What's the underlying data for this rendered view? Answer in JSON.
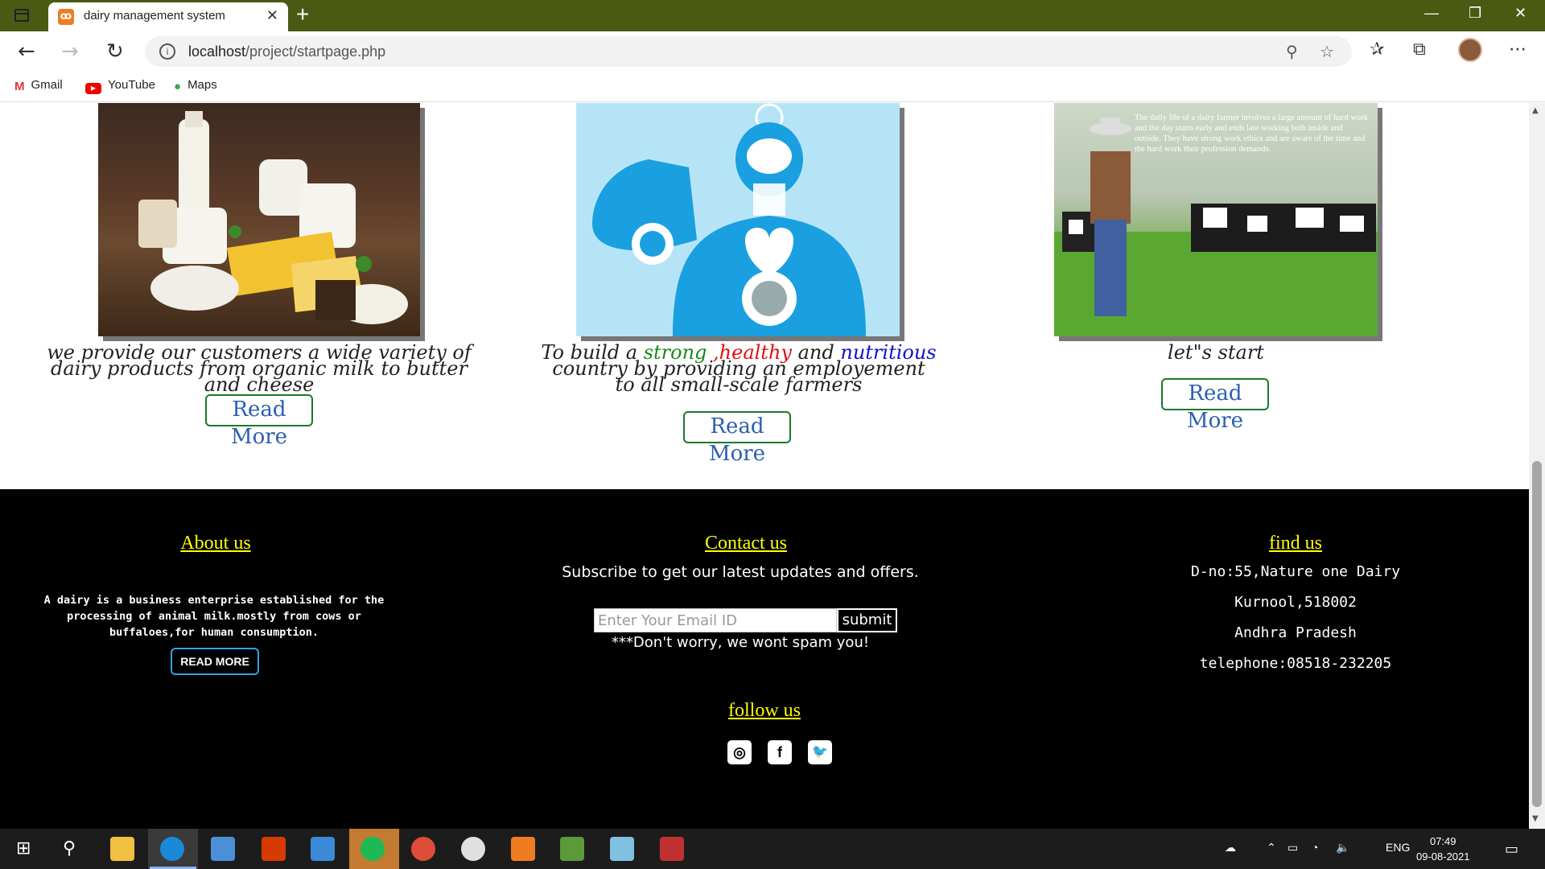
{
  "browser": {
    "tab_title": "dairy management system",
    "tab_close": "✕",
    "new_tab": "+",
    "url_host": "localhost",
    "url_path": "/project/startpage.php",
    "bookmarks": [
      {
        "label": "Gmail"
      },
      {
        "label": "YouTube"
      },
      {
        "label": "Maps"
      }
    ],
    "window_controls": [
      "—",
      "❐",
      "✕"
    ]
  },
  "cards": [
    {
      "caption": "we provide our customers a wide variety of dairy products from organic milk to butter and cheese",
      "button": "Read More"
    },
    {
      "caption_parts": [
        {
          "text": "To build a ",
          "color": "#222222"
        },
        {
          "text": "strong",
          "color": "#1a8a1a"
        },
        {
          "text": " ,healthy",
          "color": "#e01010"
        },
        {
          "text": " and ",
          "color": "#222222"
        },
        {
          "text": "nutritious",
          "color": "#1010d0"
        },
        {
          "text": " country by providing an employement to all small-scale farmers",
          "color": "#222222"
        }
      ],
      "button": "Read More"
    },
    {
      "caption": "let\"s start",
      "button": "Read More",
      "image_text": "The daily life of a dairy farmer involves a large amount of hard work and the day starts early and ends late working both inside and outside. They have strong work ethics and are aware of the time and the hard work their profession demands."
    }
  ],
  "footer": {
    "about": {
      "title": "About us",
      "text": "A dairy is a business enterprise established for the processing of animal milk.mostly from cows or buffaloes,for human consumption.",
      "button": "READ MORE"
    },
    "contact": {
      "title": "Contact us",
      "subscribe": "Subscribe to get our latest updates and offers.",
      "email_placeholder": "Enter Your Email ID",
      "submit": "submit",
      "spam": "***Don't worry, we wont spam you!"
    },
    "follow": {
      "title": "follow us",
      "icons": [
        "instagram-icon",
        "facebook-icon",
        "twitter-icon"
      ]
    },
    "find": {
      "title": "find us",
      "lines": [
        "D-no:55,Nature one Dairy",
        "Kurnool,518002",
        "Andhra Pradesh",
        "telephone:08518-232205"
      ]
    }
  },
  "taskbar": {
    "language": "ENG",
    "time": "07:49",
    "date": "09-08-2021"
  },
  "colors": {
    "titlebar": "#4a5a12",
    "footer_bg": "#000000",
    "footer_title": "#ffff00",
    "button_border": "#1a7a2a",
    "button_text": "#2b5fb0"
  }
}
